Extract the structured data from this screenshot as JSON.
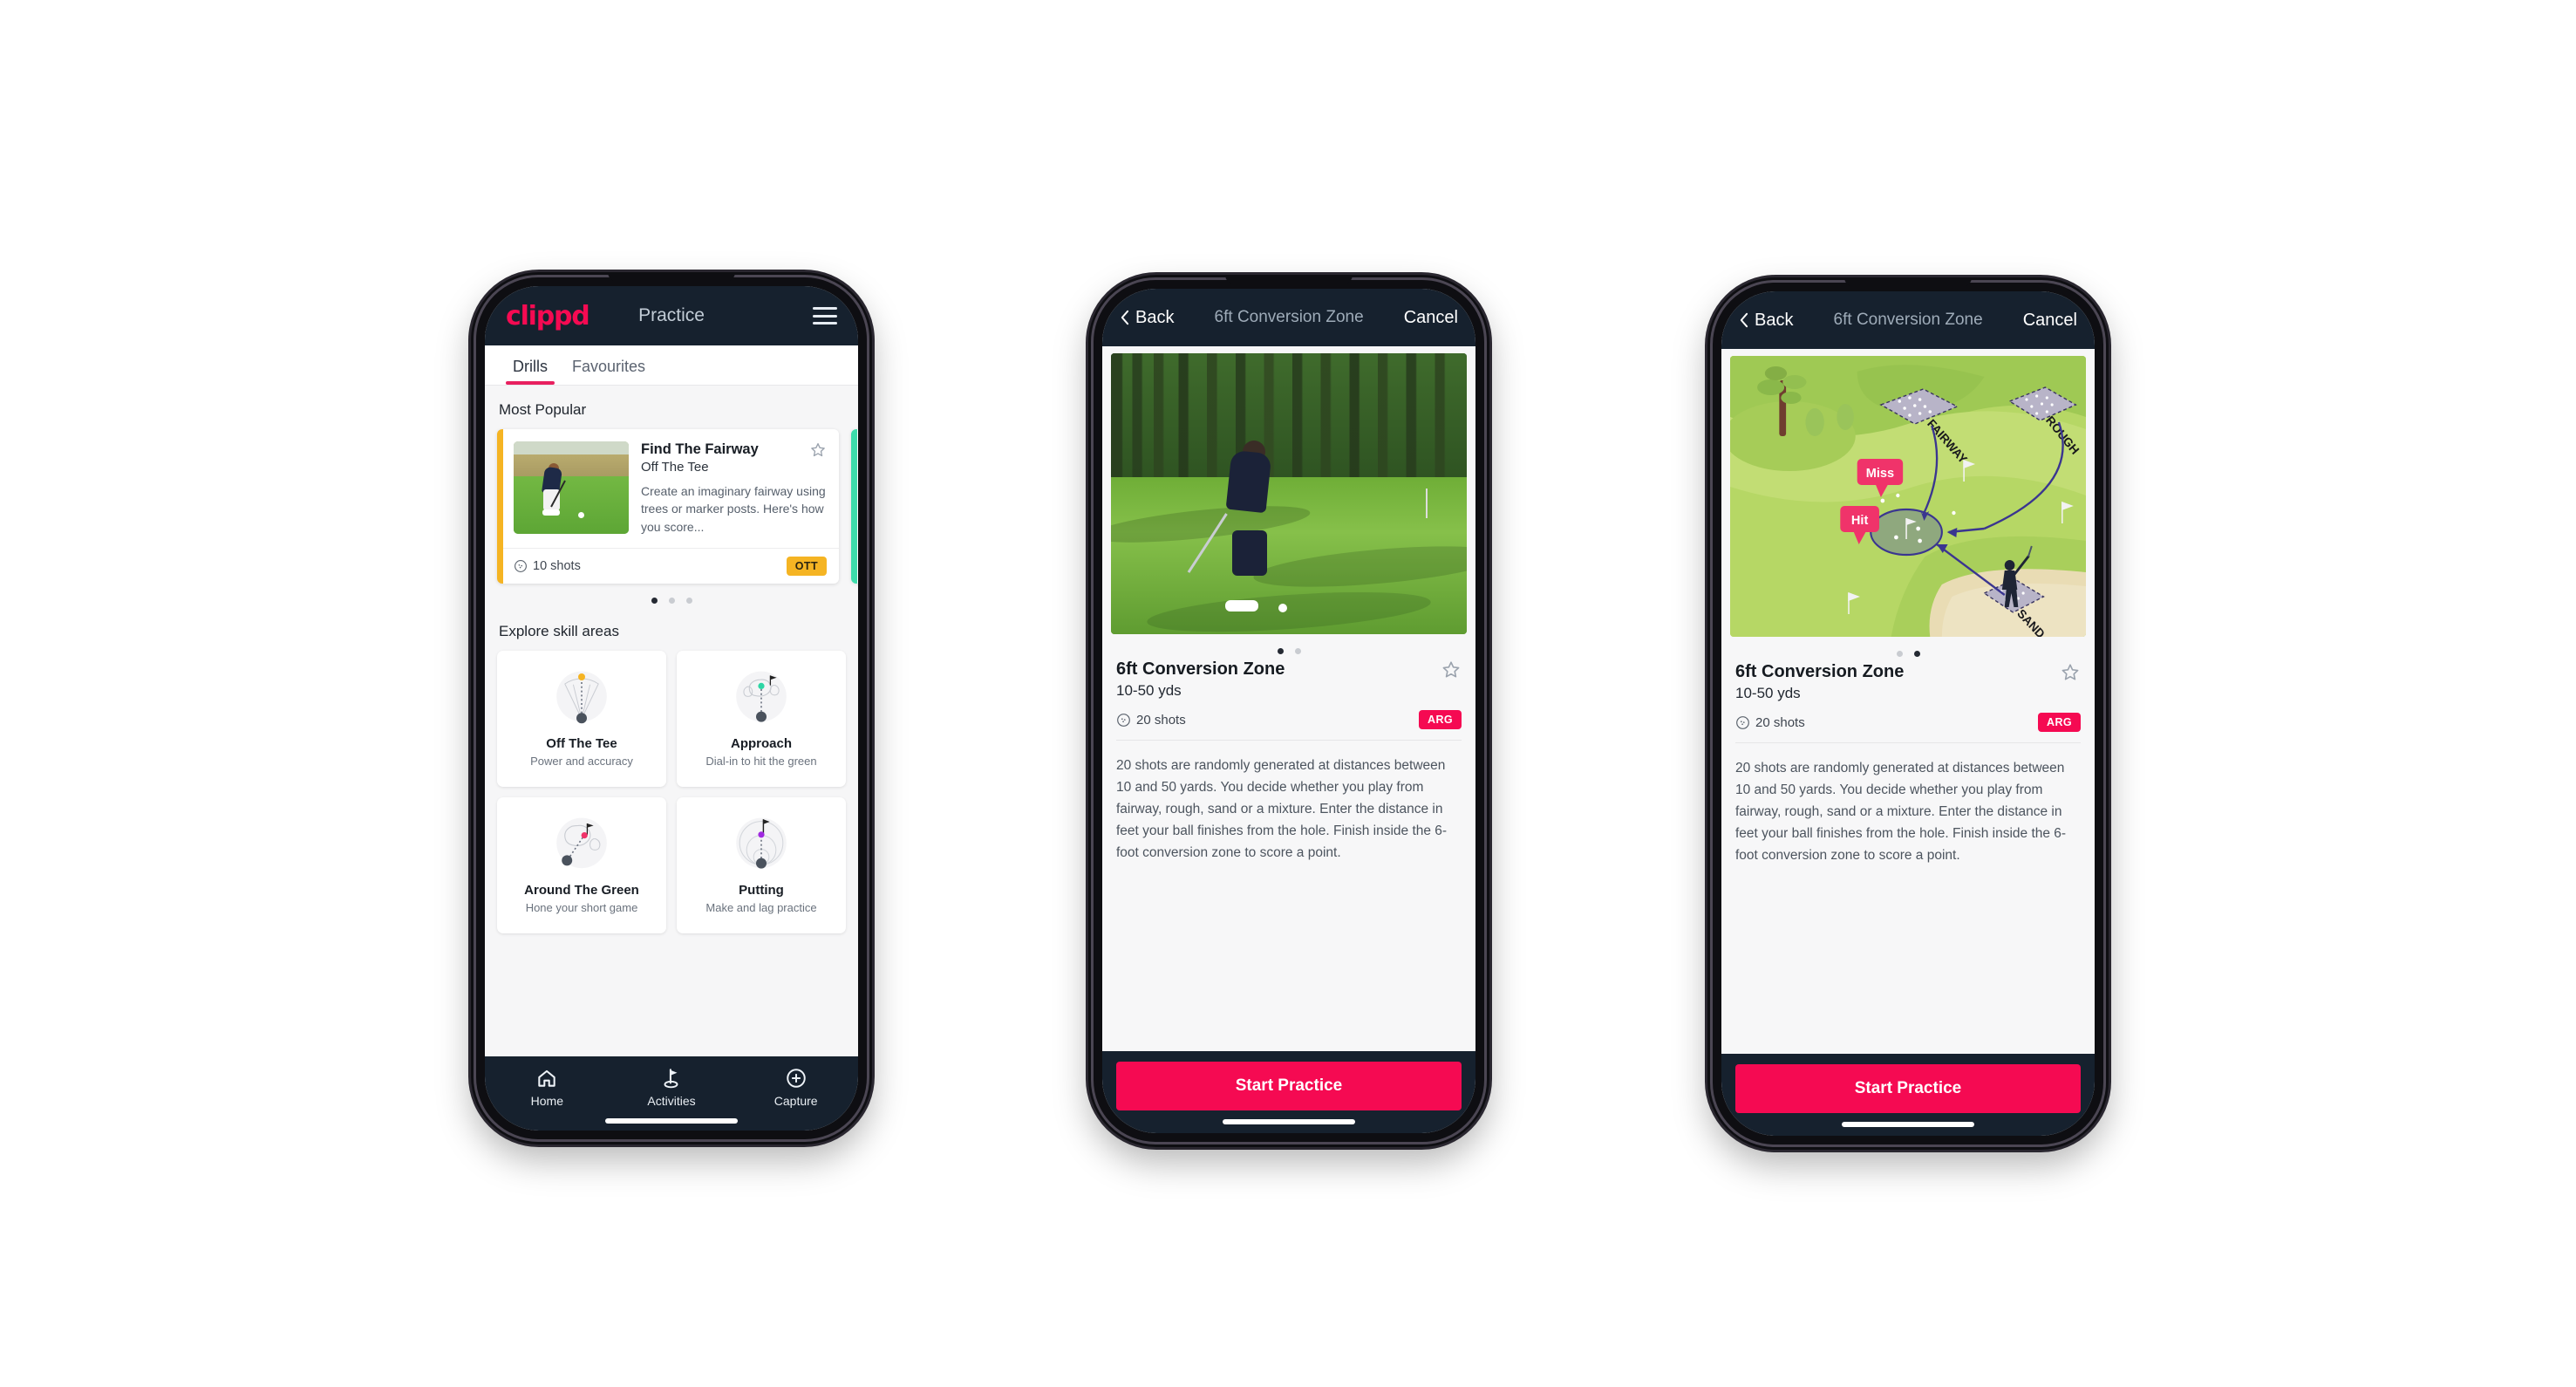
{
  "phone1": {
    "appbar": {
      "logo": "clippd",
      "title": "Practice",
      "menu_icon": "hamburger-menu-icon"
    },
    "tabs": [
      {
        "label": "Drills",
        "active": true
      },
      {
        "label": "Favourites",
        "active": false
      }
    ],
    "most_popular": {
      "section_title": "Most Popular",
      "card": {
        "title": "Find The Fairway",
        "subtitle": "Off The Tee",
        "description": "Create an imaginary fairway using trees or marker posts. Here's how you score...",
        "shots": "10 shots",
        "badge": "OTT",
        "badge_color": "#f5b423",
        "accent_color": "#f5b423",
        "favourite_icon": "star-outline-icon",
        "shots_icon": "golf-ball-icon"
      },
      "peek_accent_color": "#3ddcab",
      "dots": {
        "count": 3,
        "active_index": 0
      }
    },
    "explore": {
      "section_title": "Explore skill areas",
      "cards": [
        {
          "name": "Off The Tee",
          "desc": "Power and accuracy",
          "icon": "tee-shot-cone-icon",
          "dot_color": "#f5b423"
        },
        {
          "name": "Approach",
          "desc": "Dial-in to hit the green",
          "icon": "approach-green-icon",
          "dot_color": "#2ed6a5"
        },
        {
          "name": "Around The Green",
          "desc": "Hone your short game",
          "icon": "around-green-icon",
          "dot_color": "#f0336a"
        },
        {
          "name": "Putting",
          "desc": "Make and lag practice",
          "icon": "putting-rings-icon",
          "dot_color": "#a02ae0"
        }
      ]
    },
    "bottom_nav": [
      {
        "label": "Home",
        "icon": "home-icon",
        "active": false
      },
      {
        "label": "Activities",
        "icon": "golf-flag-icon",
        "active": true
      },
      {
        "label": "Capture",
        "icon": "plus-circle-icon",
        "active": false
      }
    ]
  },
  "phone2": {
    "bar": {
      "back": "Back",
      "title": "6ft Conversion Zone",
      "cancel": "Cancel",
      "back_icon": "chevron-left-icon"
    },
    "media_type": "photo",
    "media_alt": "golfer-chipping-photo",
    "dots": {
      "count": 2,
      "active_index": 0
    },
    "detail": {
      "title": "6ft Conversion Zone",
      "yards": "10-50 yds",
      "shots": "20 shots",
      "badge": "ARG",
      "badge_color": "#f50a52",
      "favourite_icon": "star-outline-icon",
      "shots_icon": "golf-ball-icon",
      "description": "20 shots are randomly generated at distances between 10 and 50 yards. You decide whether you play from fairway, rough, sand or a mixture. Enter the distance in feet your ball finishes from the hole. Finish inside the 6-foot conversion zone to score a point."
    },
    "cta": "Start Practice",
    "cta_color": "#f50a52"
  },
  "phone3": {
    "bar": {
      "back": "Back",
      "title": "6ft Conversion Zone",
      "cancel": "Cancel",
      "back_icon": "chevron-left-icon"
    },
    "media_type": "illustration",
    "media_alt": "golf-course-diagram",
    "illustration": {
      "zone_labels": [
        "FAIRWAY",
        "ROUGH",
        "SAND"
      ],
      "callouts": [
        {
          "text": "Miss",
          "color": "#f0336a"
        },
        {
          "text": "Hit",
          "color": "#f0336a"
        }
      ]
    },
    "dots": {
      "count": 2,
      "active_index": 1
    },
    "detail": {
      "title": "6ft Conversion Zone",
      "yards": "10-50 yds",
      "shots": "20 shots",
      "badge": "ARG",
      "badge_color": "#f50a52",
      "favourite_icon": "star-outline-icon",
      "shots_icon": "golf-ball-icon",
      "description": "20 shots are randomly generated at distances between 10 and 50 yards. You decide whether you play from fairway, rough, sand or a mixture. Enter the distance in feet your ball finishes from the hole. Finish inside the 6-foot conversion zone to score a point."
    },
    "cta": "Start Practice",
    "cta_color": "#f50a52"
  }
}
